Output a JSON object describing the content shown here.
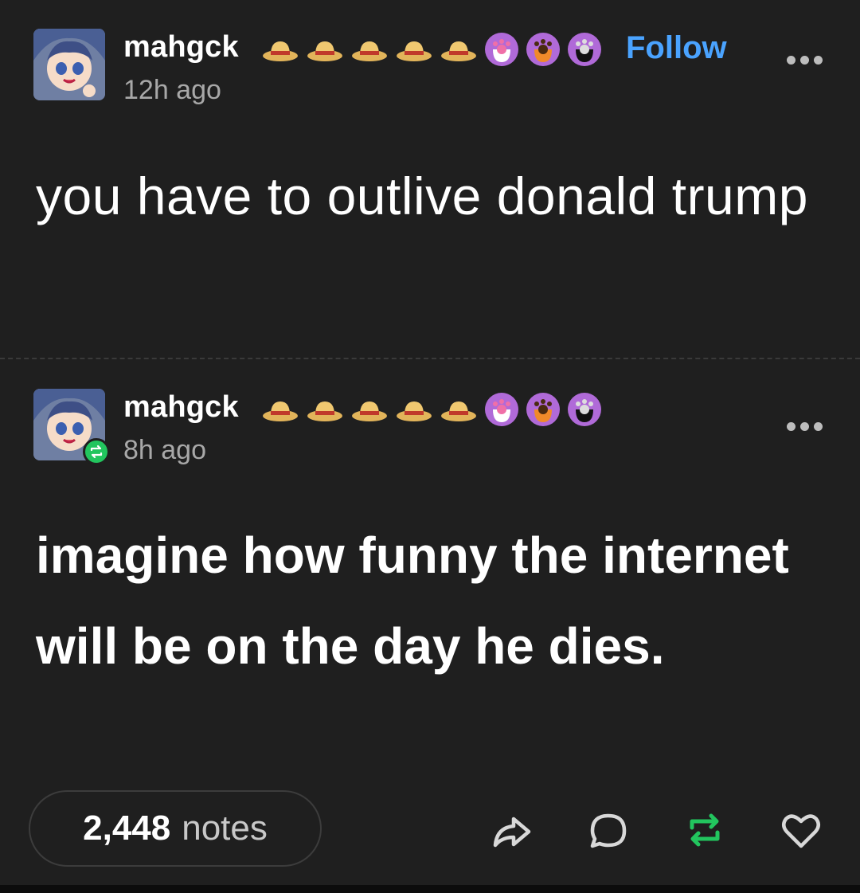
{
  "colors": {
    "background": "#1f1f1f",
    "follow": "#4aa3ff",
    "reblog_green": "#22c55e",
    "muted_text": "#a8a8a8"
  },
  "posts": [
    {
      "username": "mahgck",
      "time": "12h ago",
      "follow_label": "Follow",
      "text": "you have to outlive donald trump",
      "badges": [
        "straw-hat-icon",
        "straw-hat-icon",
        "straw-hat-icon",
        "straw-hat-icon",
        "straw-hat-icon",
        "pink-paw-icon",
        "orange-paw-icon",
        "black-paw-icon"
      ]
    },
    {
      "username": "mahgck",
      "time": "8h ago",
      "text": "imagine how funny the internet will be on the day he dies.",
      "badges": [
        "straw-hat-icon",
        "straw-hat-icon",
        "straw-hat-icon",
        "straw-hat-icon",
        "straw-hat-icon",
        "pink-paw-icon",
        "orange-paw-icon",
        "black-paw-icon"
      ]
    }
  ],
  "footer": {
    "notes_count": "2,448",
    "notes_label": "notes",
    "actions": [
      "share-icon",
      "reply-icon",
      "reblog-icon",
      "like-icon"
    ]
  }
}
